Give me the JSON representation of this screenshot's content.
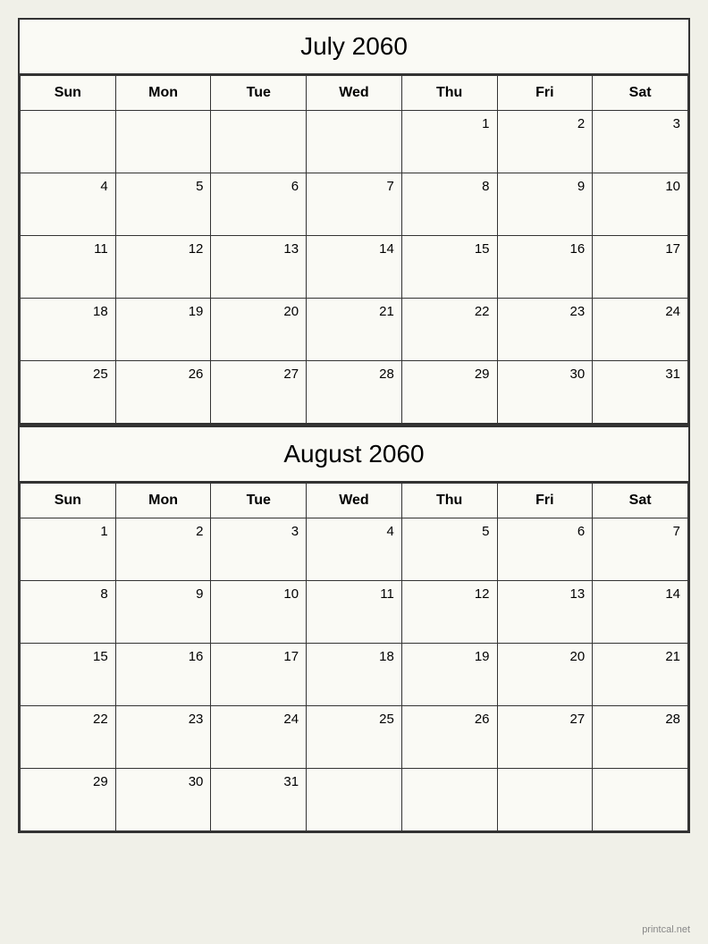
{
  "calendars": [
    {
      "id": "july-2060",
      "title": "July 2060",
      "days_of_week": [
        "Sun",
        "Mon",
        "Tue",
        "Wed",
        "Thu",
        "Fri",
        "Sat"
      ],
      "weeks": [
        [
          "",
          "",
          "",
          "",
          "1",
          "2",
          "3"
        ],
        [
          "4",
          "5",
          "6",
          "7",
          "8",
          "9",
          "10"
        ],
        [
          "11",
          "12",
          "13",
          "14",
          "15",
          "16",
          "17"
        ],
        [
          "18",
          "19",
          "20",
          "21",
          "22",
          "23",
          "24"
        ],
        [
          "25",
          "26",
          "27",
          "28",
          "29",
          "30",
          "31"
        ]
      ]
    },
    {
      "id": "august-2060",
      "title": "August 2060",
      "days_of_week": [
        "Sun",
        "Mon",
        "Tue",
        "Wed",
        "Thu",
        "Fri",
        "Sat"
      ],
      "weeks": [
        [
          "1",
          "2",
          "3",
          "4",
          "5",
          "6",
          "7"
        ],
        [
          "8",
          "9",
          "10",
          "11",
          "12",
          "13",
          "14"
        ],
        [
          "15",
          "16",
          "17",
          "18",
          "19",
          "20",
          "21"
        ],
        [
          "22",
          "23",
          "24",
          "25",
          "26",
          "27",
          "28"
        ],
        [
          "29",
          "30",
          "31",
          "",
          "",
          "",
          ""
        ]
      ]
    }
  ],
  "watermark": "printcal.net"
}
